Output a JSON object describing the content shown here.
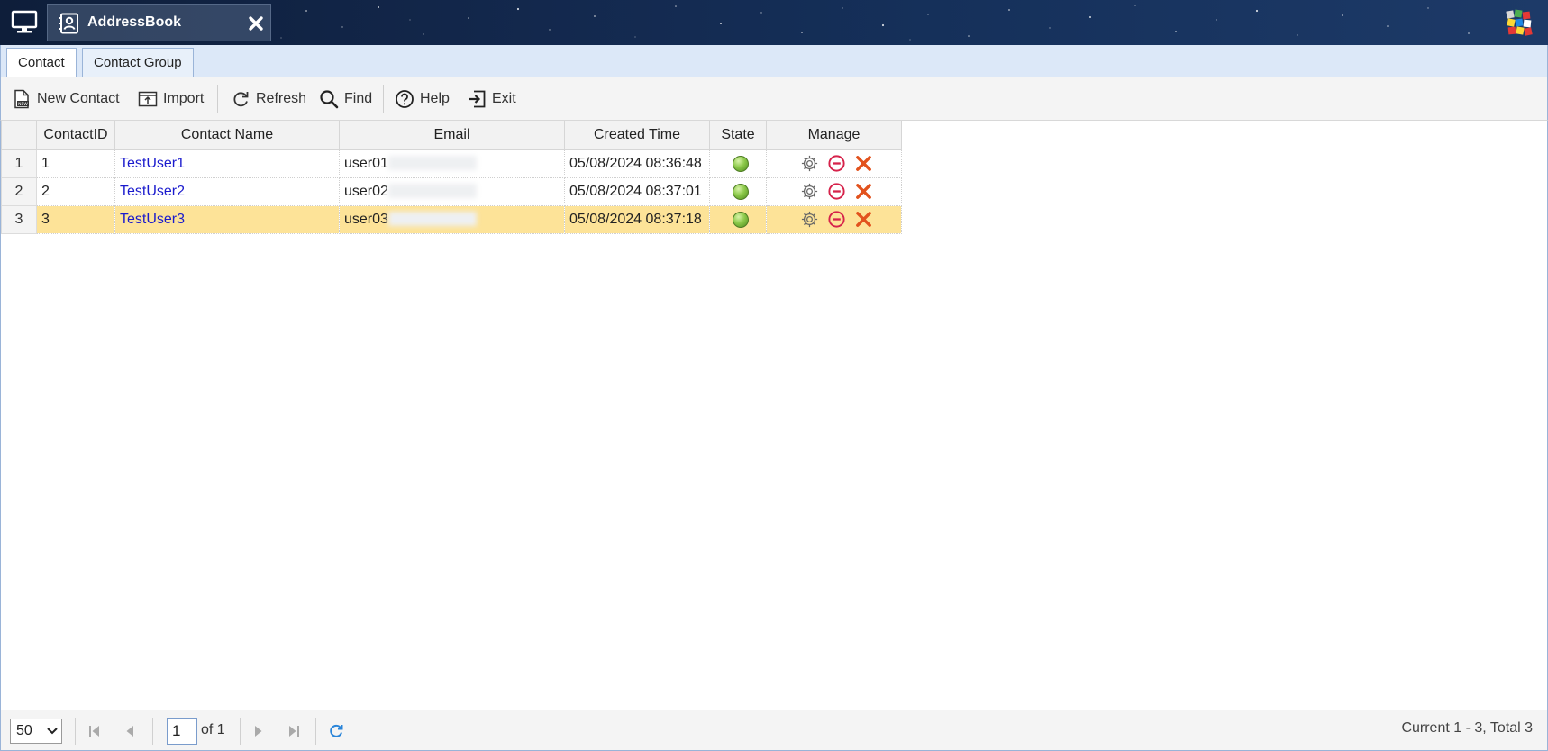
{
  "window": {
    "title": "AddressBook"
  },
  "tabs": [
    {
      "label": "Contact",
      "active": true
    },
    {
      "label": "Contact Group",
      "active": false
    }
  ],
  "toolbar": {
    "new_contact": "New Contact",
    "import": "Import",
    "refresh": "Refresh",
    "find": "Find",
    "help": "Help",
    "exit": "Exit"
  },
  "table": {
    "headers": {
      "id": "ContactID",
      "name": "Contact Name",
      "email": "Email",
      "created": "Created Time",
      "state": "State",
      "manage": "Manage"
    },
    "rows": [
      {
        "row_number": "1",
        "id": "1",
        "name": "TestUser1",
        "email": "user01",
        "created": "05/08/2024 08:36:48",
        "state": "active"
      },
      {
        "row_number": "2",
        "id": "2",
        "name": "TestUser2",
        "email": "user02",
        "created": "05/08/2024 08:37:01",
        "state": "active"
      },
      {
        "row_number": "3",
        "id": "3",
        "name": "TestUser3",
        "email": "user03",
        "created": "05/08/2024 08:37:18",
        "state": "active",
        "selected": true
      }
    ]
  },
  "pagination": {
    "page_size": "50",
    "current_page": "1",
    "of_pages": "of 1",
    "status": "Current 1 - 3, Total 3"
  },
  "colors": {
    "selected_row": "#fde398",
    "link": "#1a1acd",
    "tab_strip": "#dce8f8",
    "state_active": "#8cc94a",
    "delete_icon": "#e2521d",
    "disable_icon": "#d6234b"
  },
  "icons": [
    "desktop-icon",
    "address-book-icon",
    "close-icon",
    "app-logo-icon",
    "new-document-icon",
    "import-icon",
    "refresh-icon",
    "search-icon",
    "help-icon",
    "exit-icon",
    "gear-icon",
    "disable-icon",
    "delete-icon",
    "first-page-icon",
    "prev-page-icon",
    "next-page-icon",
    "last-page-icon",
    "reload-icon"
  ]
}
